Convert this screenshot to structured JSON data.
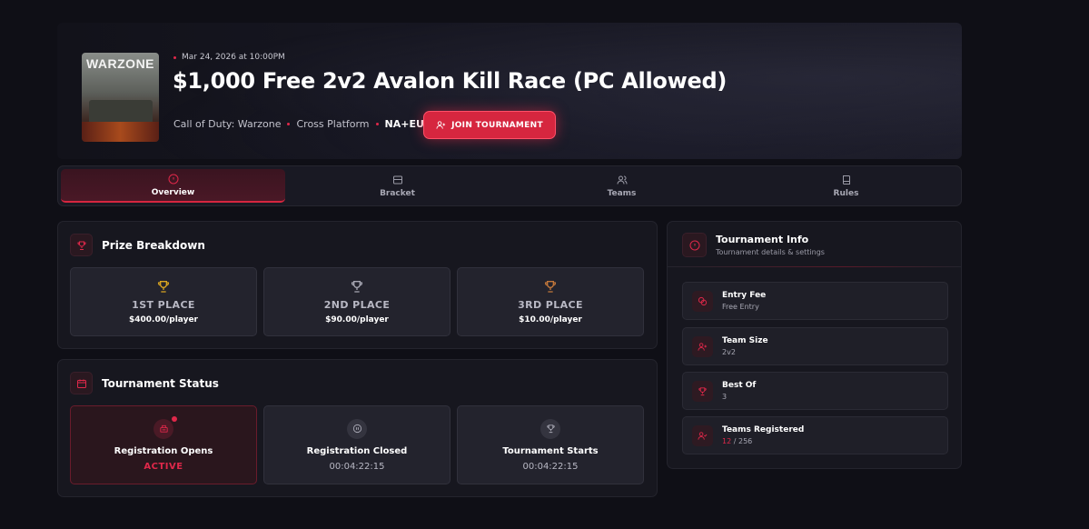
{
  "hero": {
    "cover_title": "WARZONE",
    "date": "Mar 24, 2026 at 10:00PM",
    "title": "$1,000 Free 2v2 Avalon Kill Race (PC Allowed)",
    "game": "Call of Duty: Warzone",
    "platform": "Cross Platform",
    "region": "NA+EU",
    "join_label": "JOIN TOURNAMENT"
  },
  "tabs": [
    {
      "label": "Overview",
      "icon": "info-circle-icon",
      "active": true
    },
    {
      "label": "Bracket",
      "icon": "bracket-icon",
      "active": false
    },
    {
      "label": "Teams",
      "icon": "users-icon",
      "active": false
    },
    {
      "label": "Rules",
      "icon": "book-icon",
      "active": false
    }
  ],
  "prize": {
    "title": "Prize Breakdown",
    "places": [
      {
        "place": "1ST PLACE",
        "amount": "$400.00/player",
        "color": "#d9a521"
      },
      {
        "place": "2ND PLACE",
        "amount": "$90.00/player",
        "color": "#a8a8b4"
      },
      {
        "place": "3RD PLACE",
        "amount": "$10.00/player",
        "color": "#c2773b"
      }
    ]
  },
  "status": {
    "title": "Tournament Status",
    "items": [
      {
        "label": "Registration Opens",
        "value": "ACTIVE"
      },
      {
        "label": "Registration Closed",
        "value": "00:04:22:15"
      },
      {
        "label": "Tournament Starts",
        "value": "00:04:22:15"
      }
    ]
  },
  "info": {
    "title": "Tournament Info",
    "subtitle": "Tournament details & settings",
    "rows": [
      {
        "label": "Entry Fee",
        "value": "Free Entry"
      },
      {
        "label": "Team Size",
        "value": "2v2"
      },
      {
        "label": "Best Of",
        "value": "3"
      },
      {
        "label": "Teams Registered",
        "value_current": "12",
        "value_sep": "/",
        "value_max": "256"
      }
    ]
  },
  "colors": {
    "accent": "#e0284a",
    "background": "#0f0f16"
  }
}
